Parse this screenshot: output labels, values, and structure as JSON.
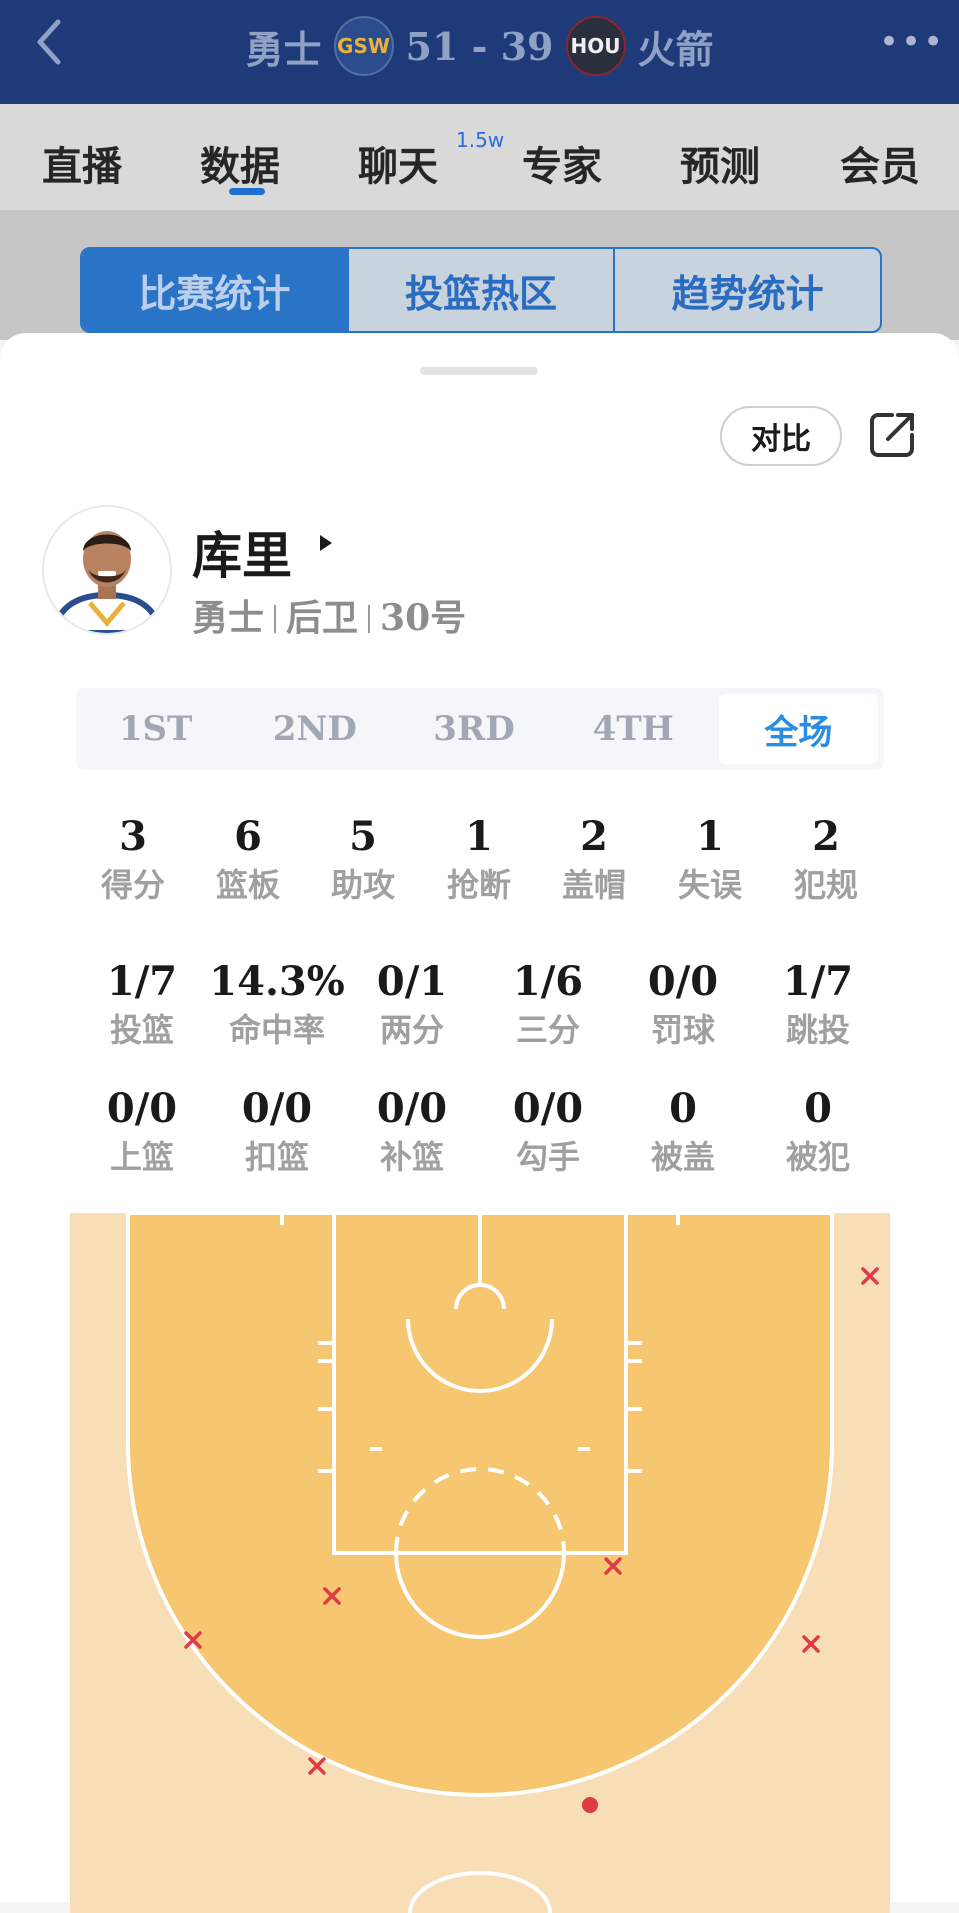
{
  "header": {
    "home_team": "勇士",
    "home_logo": "GSW",
    "score": "51 - 39",
    "away_logo": "HOU",
    "away_team": "火箭",
    "more_label": "•••"
  },
  "nav": {
    "tabs": [
      {
        "label": "直播"
      },
      {
        "label": "数据"
      },
      {
        "label": "聊天",
        "badge": "1.5w"
      },
      {
        "label": "专家"
      },
      {
        "label": "预测"
      },
      {
        "label": "会员"
      }
    ],
    "active": "数据"
  },
  "segments": [
    "比赛统计",
    "投篮热区",
    "趋势统计"
  ],
  "sheet": {
    "compare_label": "对比"
  },
  "player": {
    "name": "库里",
    "team": "勇士",
    "position": "后卫",
    "number": "30号"
  },
  "periods": [
    "1ST",
    "2ND",
    "3RD",
    "4TH",
    "全场"
  ],
  "active_period": "全场",
  "stats_row1": [
    {
      "value": "3",
      "label": "得分"
    },
    {
      "value": "6",
      "label": "篮板"
    },
    {
      "value": "5",
      "label": "助攻"
    },
    {
      "value": "1",
      "label": "抢断"
    },
    {
      "value": "2",
      "label": "盖帽"
    },
    {
      "value": "1",
      "label": "失误"
    },
    {
      "value": "2",
      "label": "犯规"
    }
  ],
  "stats_row2": [
    {
      "value": "1/7",
      "label": "投篮"
    },
    {
      "value": "14.3%",
      "label": "命中率"
    },
    {
      "value": "0/1",
      "label": "两分"
    },
    {
      "value": "1/6",
      "label": "三分"
    },
    {
      "value": "0/0",
      "label": "罚球"
    },
    {
      "value": "1/7",
      "label": "跳投"
    }
  ],
  "stats_row3": [
    {
      "value": "0/0",
      "label": "上篮"
    },
    {
      "value": "0/0",
      "label": "扣篮"
    },
    {
      "value": "0/0",
      "label": "补篮"
    },
    {
      "value": "0/0",
      "label": "勾手"
    },
    {
      "value": "0",
      "label": "被盖"
    },
    {
      "value": "0",
      "label": "被犯"
    }
  ],
  "colors": {
    "header_bg": "#1f3a78",
    "accent": "#2a74c8",
    "court_outer": "#f8deb7",
    "court_inner": "#f6c770",
    "miss": "#e03a47",
    "make": "#e03a47"
  },
  "shot_chart": {
    "made_count": 1,
    "missed_count": 6
  }
}
